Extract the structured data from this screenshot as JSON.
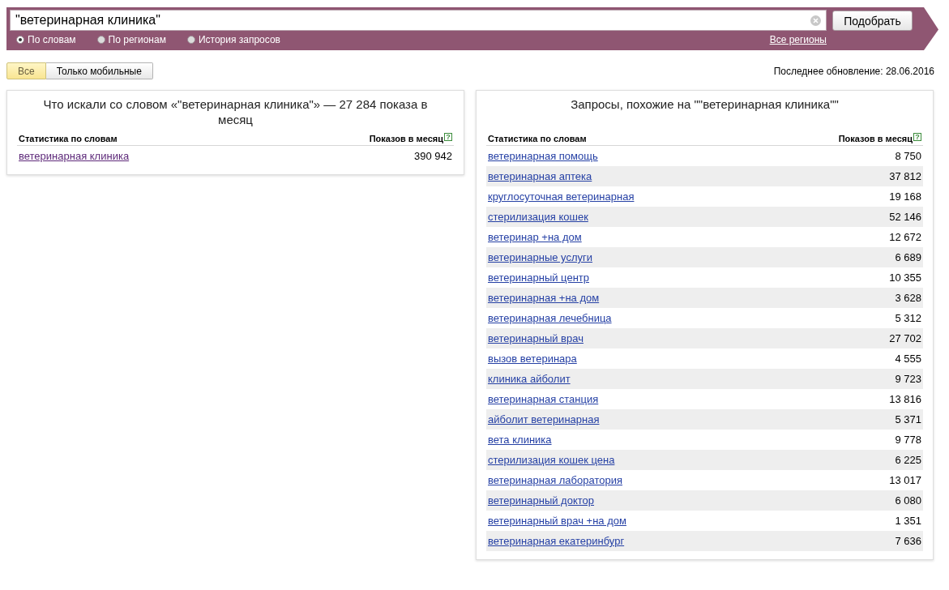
{
  "search": {
    "value": "\"ветеринарная клиника\"",
    "button": "Подобрать"
  },
  "modes": [
    {
      "label": "По словам",
      "selected": true
    },
    {
      "label": "По регионам",
      "selected": false
    },
    {
      "label": "История запросов",
      "selected": false
    }
  ],
  "region_link": "Все регионы",
  "filters": [
    {
      "label": "Все",
      "selected": true
    },
    {
      "label": "Только мобильные",
      "selected": false
    }
  ],
  "last_update": "Последнее обновление: 28.06.2016",
  "panels": [
    {
      "title": "Что искали со словом «\"ветеринарная клиника\"» — 27 284 показа в месяц",
      "columns": [
        "Статистика по словам",
        "Показов в месяц"
      ],
      "help": "?",
      "rows": [
        {
          "phrase": "ветеринарная клиника",
          "count": "390 942",
          "visited": true
        }
      ]
    },
    {
      "title": "Запросы, похожие на \"\"ветеринарная клиника\"\"",
      "columns": [
        "Статистика по словам",
        "Показов в месяц"
      ],
      "help": "?",
      "rows": [
        {
          "phrase": "ветеринарная помощь",
          "count": "8 750",
          "visited": false
        },
        {
          "phrase": "ветеринарная аптека",
          "count": "37 812",
          "visited": false
        },
        {
          "phrase": "круглосуточная ветеринарная",
          "count": "19 168",
          "visited": false
        },
        {
          "phrase": "стерилизация кошек",
          "count": "52 146",
          "visited": false
        },
        {
          "phrase": "ветеринар +на дом",
          "count": "12 672",
          "visited": false
        },
        {
          "phrase": "ветеринарные услуги",
          "count": "6 689",
          "visited": false
        },
        {
          "phrase": "ветеринарный центр",
          "count": "10 355",
          "visited": false
        },
        {
          "phrase": "ветеринарная +на дом",
          "count": "3 628",
          "visited": false
        },
        {
          "phrase": "ветеринарная лечебница",
          "count": "5 312",
          "visited": false
        },
        {
          "phrase": "ветеринарный врач",
          "count": "27 702",
          "visited": false
        },
        {
          "phrase": "вызов ветеринара",
          "count": "4 555",
          "visited": false
        },
        {
          "phrase": "клиника айболит",
          "count": "9 723",
          "visited": false
        },
        {
          "phrase": "ветеринарная станция",
          "count": "13 816",
          "visited": false
        },
        {
          "phrase": "айболит ветеринарная",
          "count": "5 371",
          "visited": false
        },
        {
          "phrase": "вета клиника",
          "count": "9 778",
          "visited": false
        },
        {
          "phrase": "стерилизация кошек цена",
          "count": "6 225",
          "visited": false
        },
        {
          "phrase": "ветеринарная лаборатория",
          "count": "13 017",
          "visited": false
        },
        {
          "phrase": "ветеринарный доктор",
          "count": "6 080",
          "visited": false
        },
        {
          "phrase": "ветеринарный врач +на дом",
          "count": "1 351",
          "visited": false
        },
        {
          "phrase": "ветеринарная екатеринбург",
          "count": "7 636",
          "visited": false
        }
      ]
    }
  ]
}
